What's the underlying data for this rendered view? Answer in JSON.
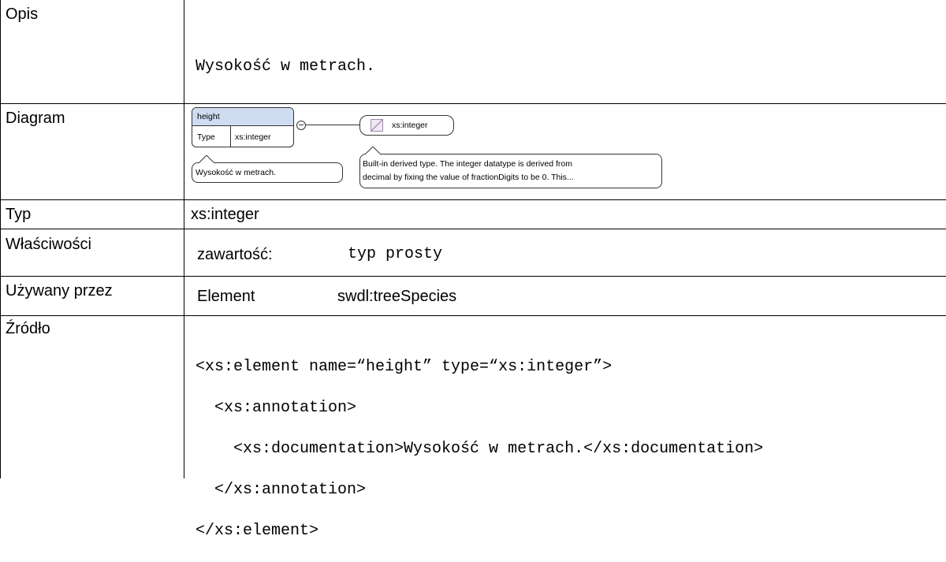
{
  "rows": {
    "opis": {
      "label": "Opis",
      "value": "Wysokość w metrach."
    },
    "diagram": {
      "label": "Diagram",
      "element_name": "height",
      "type_key": "Type",
      "type_value": "xs:integer",
      "element_annotation": "Wysokość w metrach.",
      "type_box_label": "xs:integer",
      "type_annotation_line1": "Built-in derived type. The integer datatype is derived from",
      "type_annotation_line2": "decimal by fixing the value of fractionDigits to be 0. This..."
    },
    "typ": {
      "label": "Typ",
      "value": "xs:integer"
    },
    "wlasciwosci": {
      "label": "Właściwości",
      "key": "zawartość:",
      "value": "typ prosty"
    },
    "uzywany": {
      "label": "Używany przez",
      "kind": "Element",
      "value": "swdl:treeSpecies"
    },
    "zrodlo": {
      "label": "Źródło",
      "lines": [
        "<xs:element name=“height” type=“xs:integer”>",
        "  <xs:annotation>",
        "    <xs:documentation>Wysokość w metrach.</xs:documentation>",
        "  </xs:annotation>",
        "</xs:element>"
      ]
    }
  }
}
